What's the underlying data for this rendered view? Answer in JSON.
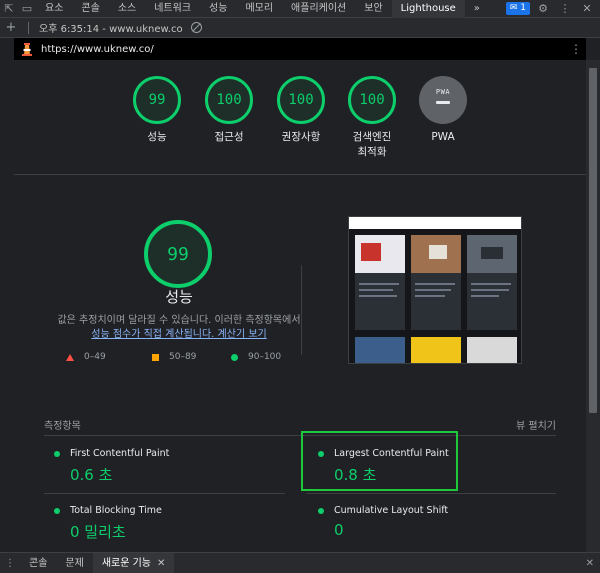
{
  "devtools": {
    "tabs": [
      "요소",
      "콘솔",
      "소스",
      "네트워크",
      "성능",
      "메모리",
      "애플리케이션",
      "보안",
      "Lighthouse"
    ],
    "active_tab": "Lighthouse",
    "more": "»",
    "badge_count": "1"
  },
  "toolbar": {
    "report_label": "오후 6:35:14 - www.uknew.co"
  },
  "urlbar": {
    "url": "https://www.uknew.co/"
  },
  "gauges": [
    {
      "score": "99",
      "label": "성능"
    },
    {
      "score": "100",
      "label": "접근성"
    },
    {
      "score": "100",
      "label": "권장사항"
    },
    {
      "score": "100",
      "label_line1": "검색엔진",
      "label_line2": "최적화"
    },
    {
      "pwa_text": "PWA",
      "label": "PWA"
    }
  ],
  "performance": {
    "score": "99",
    "title": "성능",
    "note": "값은 추정치이며 달라질 수 있습니다. 이러한 측정항목에서",
    "link": "성능 점수가 직접 계산됩니다. 계산기 보기",
    "legend": [
      "0–49",
      "50–89",
      "90–100"
    ]
  },
  "metrics": {
    "heading": "측정항목",
    "expand": "뷰 펼치기",
    "items": [
      {
        "name": "First Contentful Paint",
        "value": "0.6 초"
      },
      {
        "name": "Largest Contentful Paint",
        "value": "0.8 초"
      },
      {
        "name": "Total Blocking Time",
        "value": "0 밀리초"
      },
      {
        "name": "Cumulative Layout Shift",
        "value": "0"
      }
    ]
  },
  "drawer": {
    "tabs": [
      "콘솔",
      "문제",
      "새로운 기능"
    ],
    "active_tab": "새로운 기능"
  },
  "colors": {
    "pass": "#0cce6b",
    "average": "#ffa400",
    "fail": "#ff4e42",
    "highlight": "#1ec83c"
  }
}
